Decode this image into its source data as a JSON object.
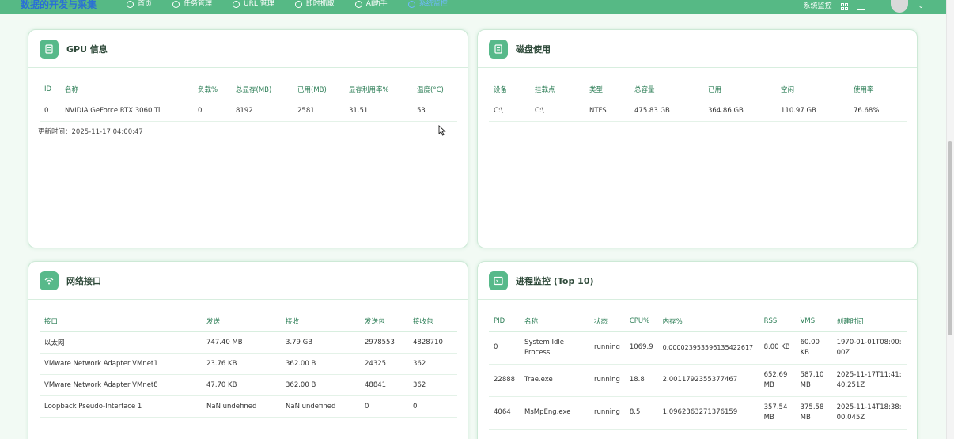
{
  "header": {
    "brand": "数据的开发与采集",
    "nav": [
      {
        "label": "首页",
        "icon": "home-icon"
      },
      {
        "label": "任务管理",
        "icon": "bug-icon"
      },
      {
        "label": "URL 管理",
        "icon": "link-icon"
      },
      {
        "label": "即时抓取",
        "icon": "cloud-download-icon"
      },
      {
        "label": "AI助手",
        "icon": "chat-icon"
      },
      {
        "label": "系统监控",
        "icon": "monitor-icon",
        "active": true
      }
    ],
    "right_label": "系统监控"
  },
  "gpu": {
    "title": "GPU 信息",
    "columns": [
      "ID",
      "名称",
      "负载%",
      "总显存(MB)",
      "已用(MB)",
      "显存利用率%",
      "温度(°C)"
    ],
    "rows": [
      [
        "0",
        "NVIDIA GeForce RTX 3060 Ti",
        "0",
        "8192",
        "2581",
        "31.51",
        "53"
      ]
    ],
    "update_time": "更新时间：2025-11-17 04:00:47"
  },
  "disk": {
    "title": "磁盘使用",
    "columns": [
      "设备",
      "挂载点",
      "类型",
      "总容量",
      "已用",
      "空闲",
      "使用率"
    ],
    "rows": [
      [
        "C:\\",
        "C:\\",
        "NTFS",
        "475.83 GB",
        "364.86 GB",
        "110.97 GB",
        "76.68%"
      ]
    ]
  },
  "network": {
    "title": "网络接口",
    "columns": [
      "接口",
      "发送",
      "接收",
      "发送包",
      "接收包"
    ],
    "rows": [
      [
        "以太网",
        "747.40 MB",
        "3.79 GB",
        "2978553",
        "4828710"
      ],
      [
        "VMware Network Adapter VMnet1",
        "23.76 KB",
        "362.00 B",
        "24325",
        "362"
      ],
      [
        "VMware Network Adapter VMnet8",
        "47.70 KB",
        "362.00 B",
        "48841",
        "362"
      ],
      [
        "Loopback Pseudo-Interface 1",
        "NaN undefined",
        "NaN undefined",
        "0",
        "0"
      ]
    ]
  },
  "process": {
    "title": "进程监控 (Top 10)",
    "columns": [
      "PID",
      "名称",
      "状态",
      "CPU%",
      "内存%",
      "RSS",
      "VMS",
      "创建时间"
    ],
    "rows": [
      [
        "0",
        "System Idle Process",
        "running",
        "1069.9",
        "0.000023953596135422617",
        "8.00 KB",
        "60.00 KB",
        "1970-01-01T08:00:00Z"
      ],
      [
        "22888",
        "Trae.exe",
        "running",
        "18.8",
        "2.0011792355377467",
        "652.69 MB",
        "587.10 MB",
        "2025-11-17T11:41:40.251Z"
      ],
      [
        "4064",
        "MsMpEng.exe",
        "running",
        "8.5",
        "1.0962363271376159",
        "357.54 MB",
        "375.58 MB",
        "2025-11-14T18:38:00.045Z"
      ]
    ]
  }
}
